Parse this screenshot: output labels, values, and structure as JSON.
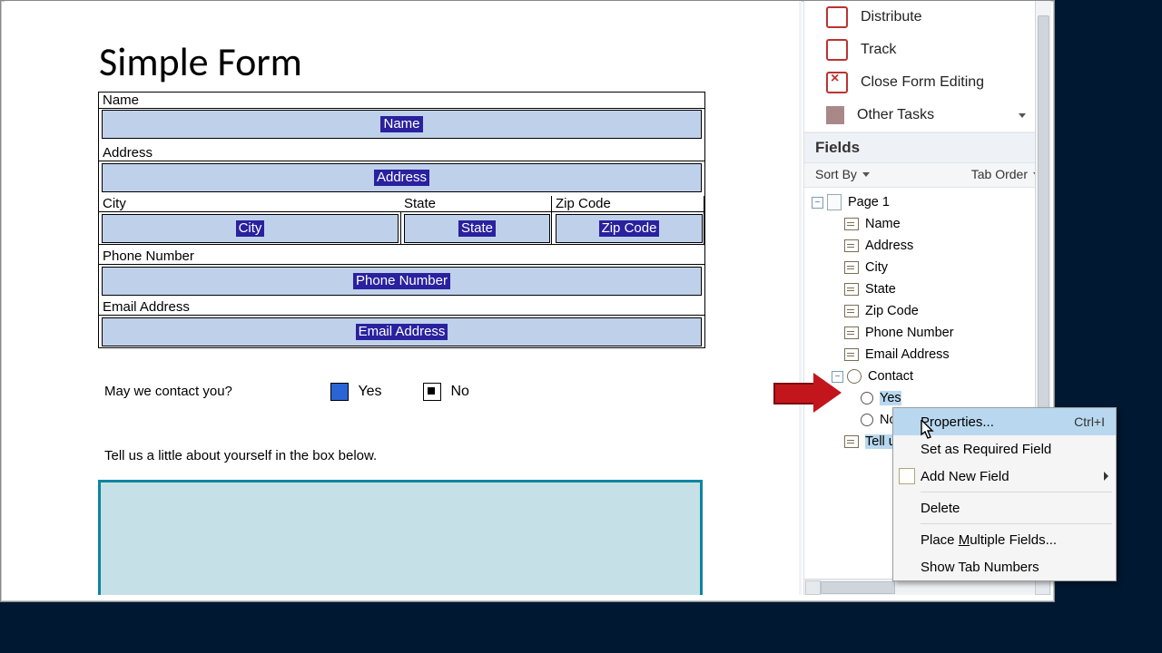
{
  "form": {
    "title": "Simple Form",
    "name": {
      "label": "Name",
      "field_tag": "Name"
    },
    "address": {
      "label": "Address",
      "field_tag": "Address"
    },
    "city": {
      "label": "City",
      "field_tag": "City"
    },
    "state": {
      "label": "State",
      "field_tag": "State"
    },
    "zip": {
      "label": "Zip Code",
      "field_tag": "Zip Code"
    },
    "phone": {
      "label": "Phone Number",
      "field_tag": "Phone Number"
    },
    "email": {
      "label": "Email Address",
      "field_tag": "Email Address"
    },
    "contact_question": "May we contact you?",
    "yes": "Yes",
    "no": "No",
    "about": "Tell us a little about yourself in the box below."
  },
  "panel": {
    "distribute": "Distribute",
    "track": "Track",
    "close_form": "Close Form Editing",
    "other_tasks": "Other Tasks",
    "fields_header": "Fields",
    "sort_by": "Sort By",
    "tab_order": "Tab Order"
  },
  "tree": {
    "page": "Page 1",
    "items": [
      "Name",
      "Address",
      "City",
      "State",
      "Zip Code",
      "Phone Number",
      "Email Address"
    ],
    "contact": "Contact",
    "yes": "Yes",
    "no": "No",
    "tell_us": "Tell us a little about yourself"
  },
  "context": {
    "properties": "Properties...",
    "properties_sc": "Ctrl+I",
    "required": "Set as Required Field",
    "add_new": "Add New Field",
    "delete": "Delete",
    "place_multi_pre": "Place ",
    "place_multi_u": "M",
    "place_multi_post": "ultiple Fields...",
    "show_tab": "Show Tab Numbers"
  }
}
